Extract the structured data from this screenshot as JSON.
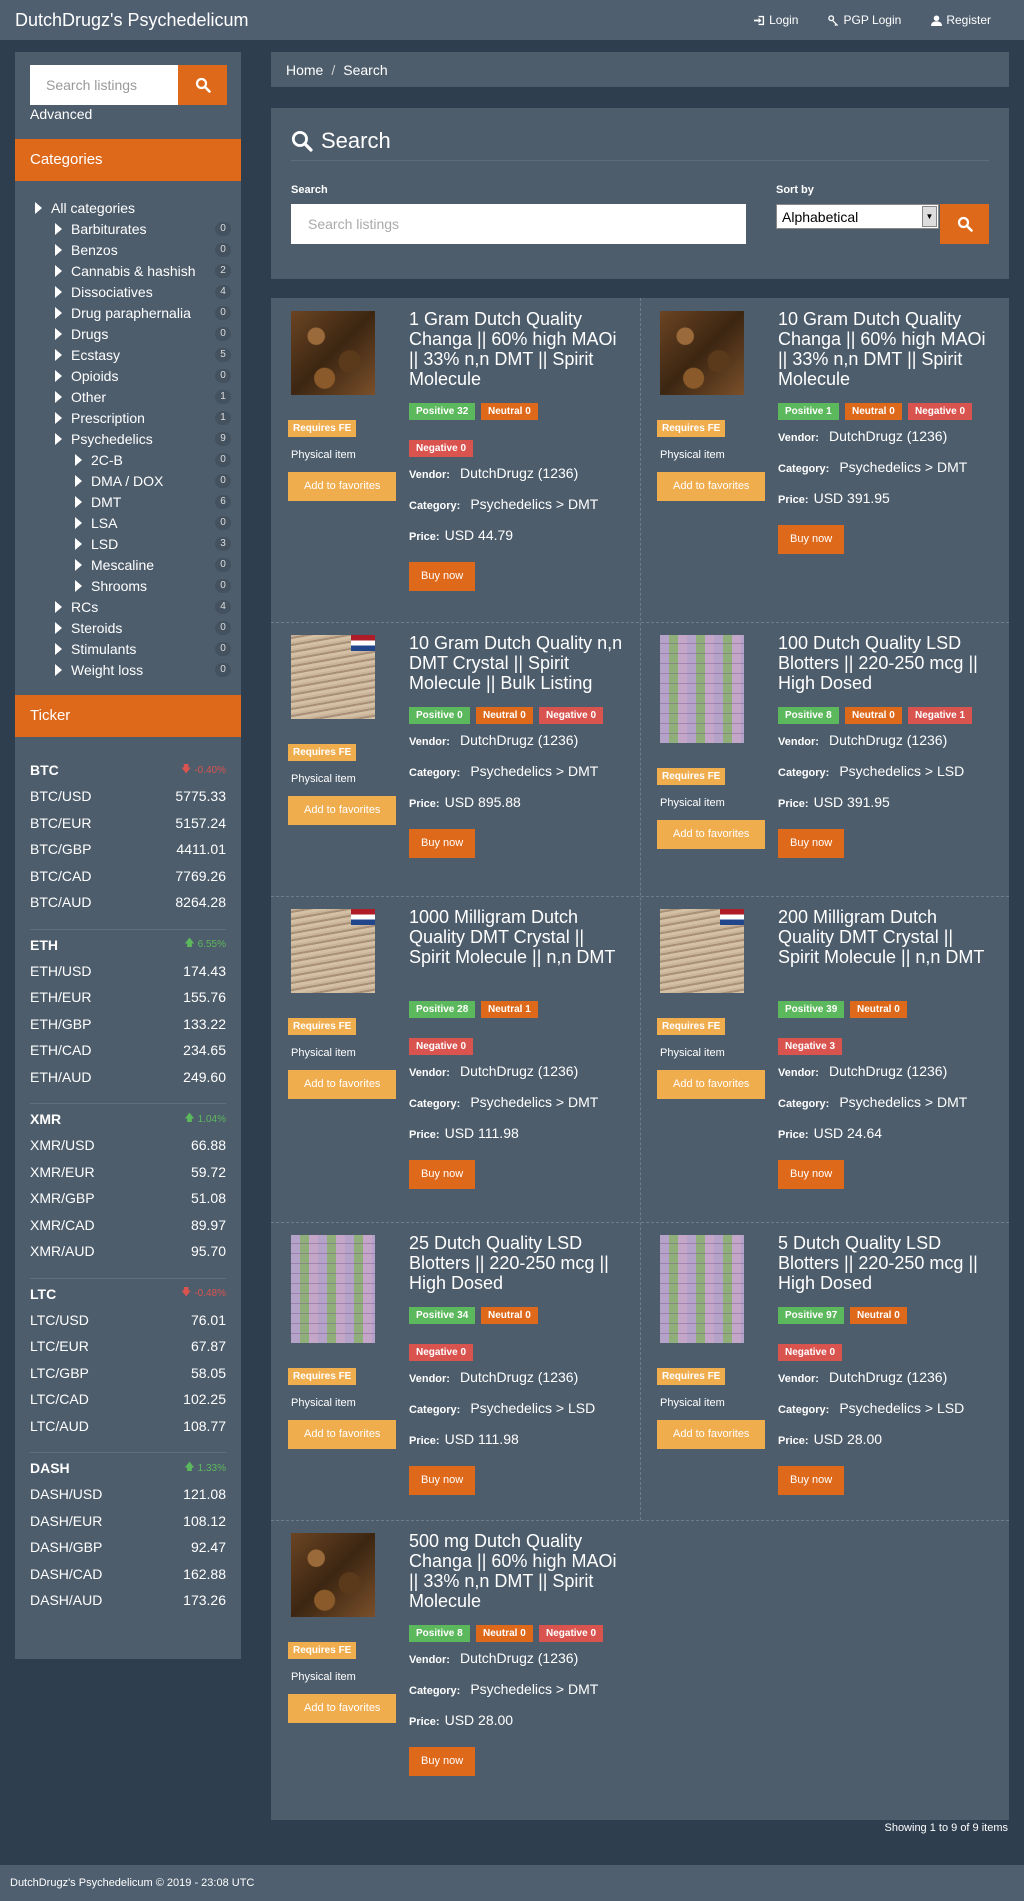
{
  "navbar": {
    "brand": "DutchDrugz's Psychedelicum",
    "login": "Login",
    "pgp_login": "PGP Login",
    "register": "Register"
  },
  "sidebar": {
    "search_placeholder": "Search listings",
    "advanced": "Advanced",
    "categories_title": "Categories",
    "categories": [
      {
        "label": "All categories",
        "count": ""
      },
      {
        "label": "Barbiturates",
        "count": "0"
      },
      {
        "label": "Benzos",
        "count": "0"
      },
      {
        "label": "Cannabis & hashish",
        "count": "2"
      },
      {
        "label": "Dissociatives",
        "count": "4"
      },
      {
        "label": "Drug paraphernalia",
        "count": "0"
      },
      {
        "label": "Drugs",
        "count": "0"
      },
      {
        "label": "Ecstasy",
        "count": "5"
      },
      {
        "label": "Opioids",
        "count": "0"
      },
      {
        "label": "Other",
        "count": "1"
      },
      {
        "label": "Prescription",
        "count": "1"
      },
      {
        "label": "Psychedelics",
        "count": "9"
      },
      {
        "label": "2C-B",
        "count": "0"
      },
      {
        "label": "DMA / DOX",
        "count": "0"
      },
      {
        "label": "DMT",
        "count": "6"
      },
      {
        "label": "LSA",
        "count": "0"
      },
      {
        "label": "LSD",
        "count": "3"
      },
      {
        "label": "Mescaline",
        "count": "0"
      },
      {
        "label": "Shrooms",
        "count": "0"
      },
      {
        "label": "RCs",
        "count": "4"
      },
      {
        "label": "Steroids",
        "count": "0"
      },
      {
        "label": "Stimulants",
        "count": "0"
      },
      {
        "label": "Weight loss",
        "count": "0"
      }
    ],
    "ticker_title": "Ticker",
    "ticker": [
      {
        "coin": "BTC",
        "change": "-0.40%",
        "dir": "down",
        "rows": [
          [
            "BTC/USD",
            "5775.33"
          ],
          [
            "BTC/EUR",
            "5157.24"
          ],
          [
            "BTC/GBP",
            "4411.01"
          ],
          [
            "BTC/CAD",
            "7769.26"
          ],
          [
            "BTC/AUD",
            "8264.28"
          ]
        ]
      },
      {
        "coin": "ETH",
        "change": "6.55%",
        "dir": "up",
        "rows": [
          [
            "ETH/USD",
            "174.43"
          ],
          [
            "ETH/EUR",
            "155.76"
          ],
          [
            "ETH/GBP",
            "133.22"
          ],
          [
            "ETH/CAD",
            "234.65"
          ],
          [
            "ETH/AUD",
            "249.60"
          ]
        ]
      },
      {
        "coin": "XMR",
        "change": "1.04%",
        "dir": "up",
        "rows": [
          [
            "XMR/USD",
            "66.88"
          ],
          [
            "XMR/EUR",
            "59.72"
          ],
          [
            "XMR/GBP",
            "51.08"
          ],
          [
            "XMR/CAD",
            "89.97"
          ],
          [
            "XMR/AUD",
            "95.70"
          ]
        ]
      },
      {
        "coin": "LTC",
        "change": "-0.48%",
        "dir": "down",
        "rows": [
          [
            "LTC/USD",
            "76.01"
          ],
          [
            "LTC/EUR",
            "67.87"
          ],
          [
            "LTC/GBP",
            "58.05"
          ],
          [
            "LTC/CAD",
            "102.25"
          ],
          [
            "LTC/AUD",
            "108.77"
          ]
        ]
      },
      {
        "coin": "DASH",
        "change": "1.33%",
        "dir": "up",
        "rows": [
          [
            "DASH/USD",
            "121.08"
          ],
          [
            "DASH/EUR",
            "108.12"
          ],
          [
            "DASH/GBP",
            "92.47"
          ],
          [
            "DASH/CAD",
            "162.88"
          ],
          [
            "DASH/AUD",
            "173.26"
          ]
        ]
      }
    ]
  },
  "breadcrumb": {
    "home": "Home",
    "sep": "/",
    "current": "Search"
  },
  "search_panel": {
    "title": "Search",
    "search_label": "Search",
    "search_placeholder": "Search listings",
    "sort_label": "Sort by",
    "sort_value": "Alphabetical"
  },
  "labels": {
    "requires_fe": "Requires FE",
    "physical": "Physical item",
    "favorites": "Add to favorites",
    "vendor": "Vendor:",
    "category": "Category:",
    "price": "Price:",
    "buy": "Buy now"
  },
  "listings": [
    {
      "title": "1 Gram Dutch Quality Changa || 60% high MAOi || 33% n,n DMT || Spirit Molecule",
      "img": "changa",
      "flag": false,
      "positive": "Positive 32",
      "neutral": "Neutral 0",
      "negative": "Negative 0",
      "vendor": "DutchDrugz (1236)",
      "category": "Psychedelics > DMT",
      "price": "USD 44.79"
    },
    {
      "title": "10 Gram Dutch Quality Changa || 60% high MAOi || 33% n,n DMT || Spirit Molecule",
      "img": "changa",
      "flag": false,
      "positive": "Positive 1",
      "neutral": "Neutral 0",
      "negative": "Negative 0",
      "vendor": "DutchDrugz (1236)",
      "category": "Psychedelics > DMT",
      "price": "USD 391.95"
    },
    {
      "title": "10 Gram Dutch Quality n,n DMT Crystal || Spirit Molecule || Bulk Listing",
      "img": "crystal",
      "flag": true,
      "positive": "Positive 0",
      "neutral": "Neutral 0",
      "negative": "Negative 0",
      "vendor": "DutchDrugz (1236)",
      "category": "Psychedelics > DMT",
      "price": "USD 895.88"
    },
    {
      "title": "100 Dutch Quality LSD Blotters || 220-250 mcg || High Dosed",
      "img": "lsd",
      "flag": false,
      "positive": "Positive 8",
      "neutral": "Neutral 0",
      "negative": "Negative 1",
      "vendor": "DutchDrugz (1236)",
      "category": "Psychedelics > LSD",
      "price": "USD 391.95"
    },
    {
      "title": "1000 Milligram Dutch Quality DMT Crystal || Spirit Molecule || n,n DMT",
      "img": "crystal",
      "flag": true,
      "positive": "Positive 28",
      "neutral": "Neutral 1",
      "negative": "Negative 0",
      "vendor": "DutchDrugz (1236)",
      "category": "Psychedelics > DMT",
      "price": "USD 111.98"
    },
    {
      "title": "200 Milligram Dutch Quality DMT Crystal || Spirit Molecule || n,n DMT",
      "img": "crystal",
      "flag": true,
      "positive": "Positive 39",
      "neutral": "Neutral 0",
      "negative": "Negative 3",
      "vendor": "DutchDrugz (1236)",
      "category": "Psychedelics > DMT",
      "price": "USD 24.64"
    },
    {
      "title": "25 Dutch Quality LSD Blotters || 220-250 mcg || High Dosed",
      "img": "lsd",
      "flag": false,
      "positive": "Positive 34",
      "neutral": "Neutral 0",
      "negative": "Negative 0",
      "vendor": "DutchDrugz (1236)",
      "category": "Psychedelics > LSD",
      "price": "USD 111.98"
    },
    {
      "title": "5 Dutch Quality LSD Blotters || 220-250 mcg || High Dosed",
      "img": "lsd",
      "flag": false,
      "positive": "Positive 97",
      "neutral": "Neutral 0",
      "negative": "Negative 0",
      "vendor": "DutchDrugz (1236)",
      "category": "Psychedelics > LSD",
      "price": "USD 28.00"
    },
    {
      "title": "500 mg Dutch Quality Changa || 60% high MAOi || 33% n,n DMT || Spirit Molecule",
      "img": "changa",
      "flag": false,
      "positive": "Positive 8",
      "neutral": "Neutral 0",
      "negative": "Negative 0",
      "vendor": "DutchDrugz (1236)",
      "category": "Psychedelics > DMT",
      "price": "USD 28.00"
    }
  ],
  "showing": "Showing 1 to 9 of 9 items",
  "footer": "DutchDrugz's Psychedelicum © 2019 - 23:08 UTC"
}
